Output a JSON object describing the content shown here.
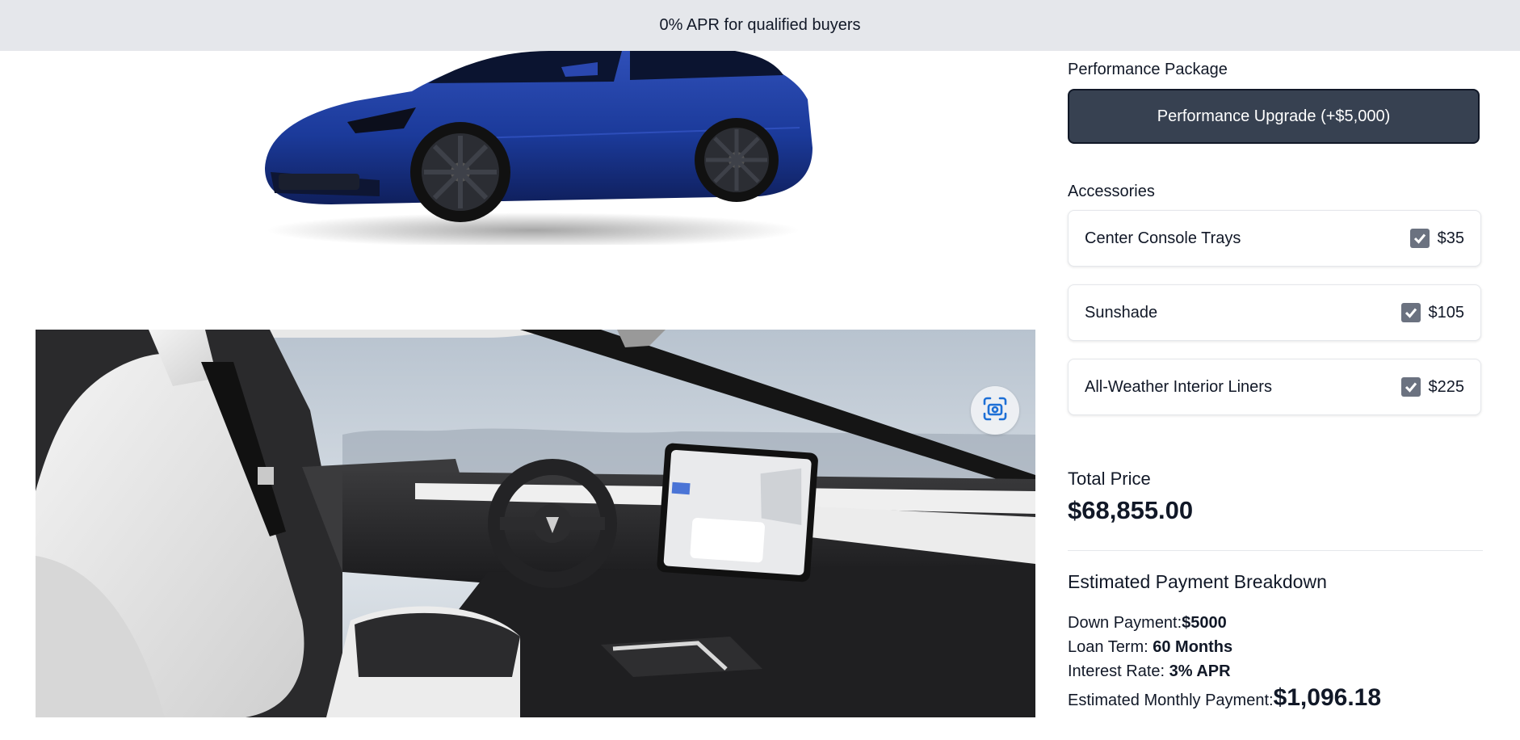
{
  "banner": {
    "text": "0% APR for qualified buyers"
  },
  "performance": {
    "section_label": "Performance Package",
    "button_label": "Performance Upgrade (+$5,000)"
  },
  "accessories": {
    "section_label": "Accessories",
    "items": [
      {
        "name": "Center Console Trays",
        "price": "$35",
        "checked": true
      },
      {
        "name": "Sunshade",
        "price": "$105",
        "checked": true
      },
      {
        "name": "All-Weather Interior Liners",
        "price": "$225",
        "checked": true
      }
    ]
  },
  "total": {
    "label": "Total Price",
    "value": "$68,855.00"
  },
  "breakdown": {
    "title": "Estimated Payment Breakdown",
    "down_payment_label": "Down Payment:",
    "down_payment_value": "$5000",
    "loan_term_label": "Loan Term:",
    "loan_term_value": "60 Months",
    "interest_rate_label": "Interest Rate:",
    "interest_rate_value": "3% APR",
    "monthly_label": "Estimated Monthly Payment:",
    "monthly_value": "$1,096.18"
  },
  "colors": {
    "banner_bg": "#e5e7eb",
    "button_bg": "#374151",
    "car_paint": "#1e3a8a",
    "zoom_icon": "#1d6fd6"
  }
}
